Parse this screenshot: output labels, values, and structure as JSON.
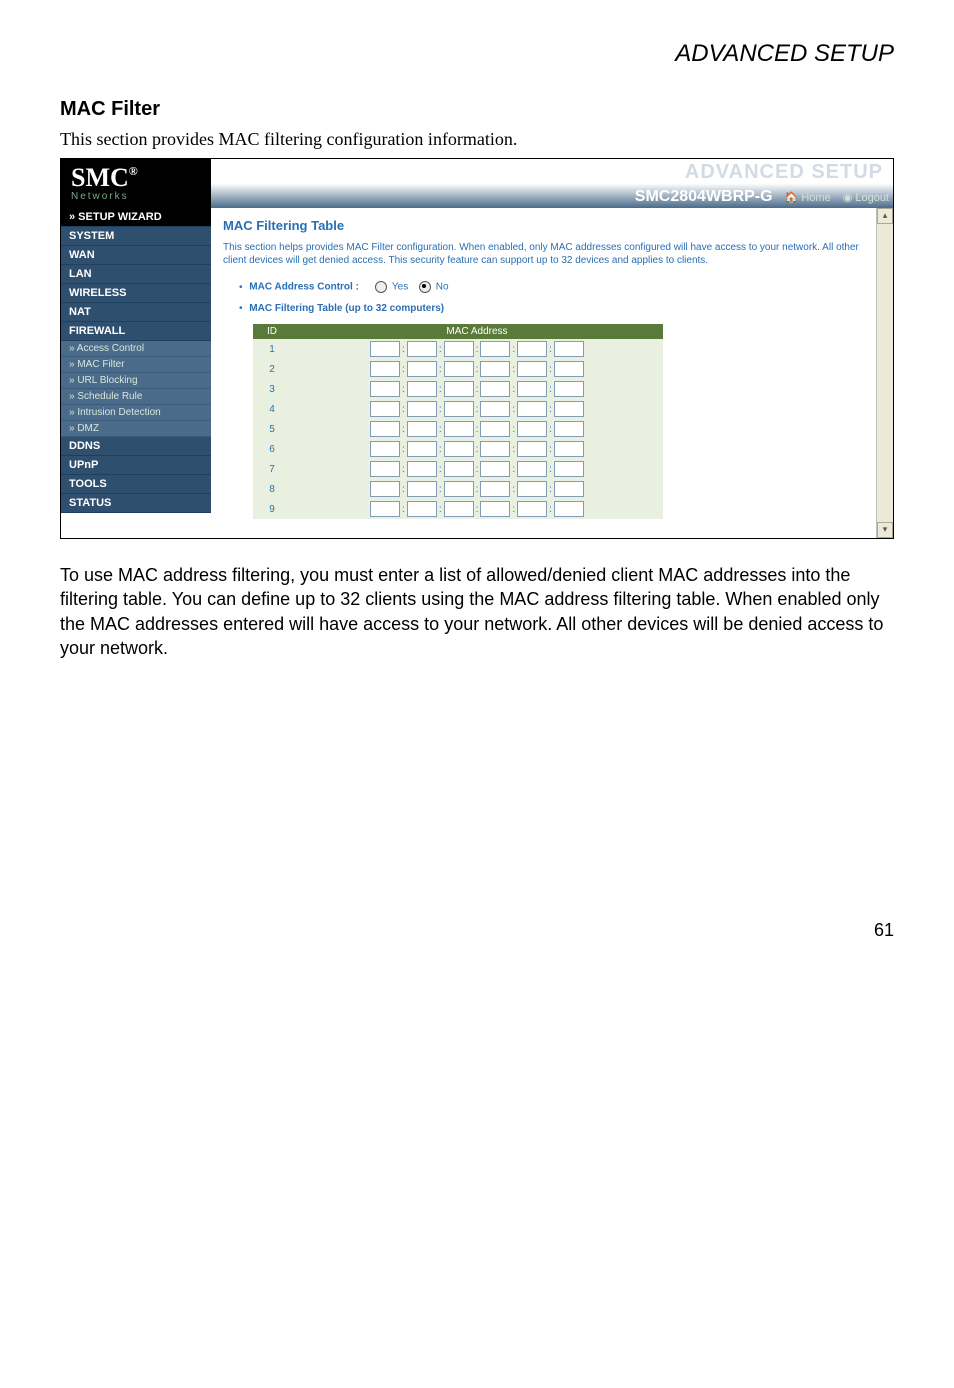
{
  "page_header": "ADVANCED SETUP",
  "section_title": "MAC Filter",
  "intro": "This section provides MAC filtering configuration information.",
  "screenshot": {
    "logo": {
      "main": "SMC",
      "reg": "®",
      "sub": "Networks"
    },
    "ghost": "ADVANCED SETUP",
    "model": "SMC2804WBRP-G",
    "links": {
      "home": "Home",
      "logout": "Logout"
    },
    "nav": {
      "setup_wizard": "» SETUP WIZARD",
      "system": "SYSTEM",
      "wan": "WAN",
      "lan": "LAN",
      "wireless": "WIRELESS",
      "nat": "NAT",
      "firewall": "FIREWALL",
      "ddns": "DDNS",
      "upnp": "UPnP",
      "tools": "TOOLS",
      "status": "STATUS"
    },
    "sub": {
      "access": "» Access Control",
      "mac": "» MAC Filter",
      "url": "» URL Blocking",
      "sched": "» Schedule Rule",
      "intr": "» Intrusion Detection",
      "dmz": "» DMZ"
    },
    "panel": {
      "title": "MAC Filtering Table",
      "desc": "This section helps provides MAC Filter configuration. When enabled, only MAC addresses configured will have access to your network. All other client devices will get denied access. This security feature can support up to 32 devices and applies to clients.",
      "control_label": "MAC Address Control :",
      "yes": "Yes",
      "no": "No",
      "table_label": "MAC Filtering Table (up to 32 computers)",
      "col_id": "ID",
      "col_mac": "MAC Address",
      "rows": [
        "1",
        "2",
        "3",
        "4",
        "5",
        "6",
        "7",
        "8",
        "9"
      ]
    }
  },
  "body_para": "To use MAC address filtering, you must enter a list of allowed/denied client MAC addresses into the filtering table. You can define up to 32 clients using the MAC address filtering table. When enabled only the MAC addresses entered will have access to your network. All other devices will be denied access to your network.",
  "page_num": "61"
}
